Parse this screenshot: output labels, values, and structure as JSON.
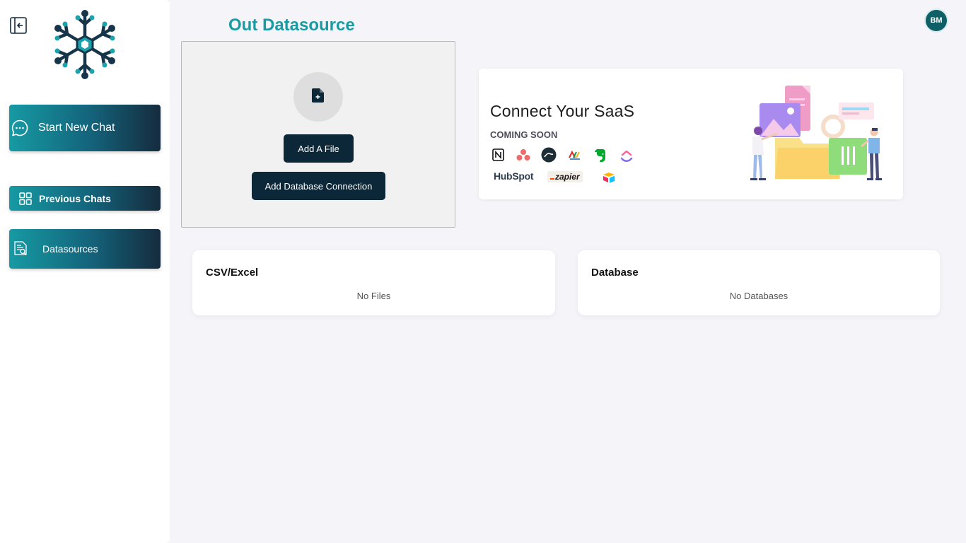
{
  "sidebar": {
    "new_chat_label": "Start New Chat",
    "previous_chats_label": "Previous Chats",
    "datasources_label": "Datasources",
    "accent_color": "#169aa3",
    "dark_color": "#152b3d"
  },
  "header": {
    "title": "Out Datasource",
    "avatar_initials": "BM"
  },
  "upload": {
    "add_file_label": "Add A File",
    "add_db_label": "Add Database Connection"
  },
  "saas": {
    "title": "Connect Your SaaS",
    "subtitle": "COMING SOON",
    "integrations": [
      "notion-icon",
      "asana-icon",
      "basecamp-icon",
      "zoho-icon",
      "evernote-icon",
      "clickup-icon",
      "hubspot-logo",
      "zapier-logo",
      "airtable-icon"
    ],
    "hubspot_text": "HubSpot",
    "zapier_text": "zapier"
  },
  "sections": {
    "csv": {
      "title": "CSV/Excel",
      "empty": "No Files"
    },
    "database": {
      "title": "Database",
      "empty": "No Databases"
    }
  }
}
